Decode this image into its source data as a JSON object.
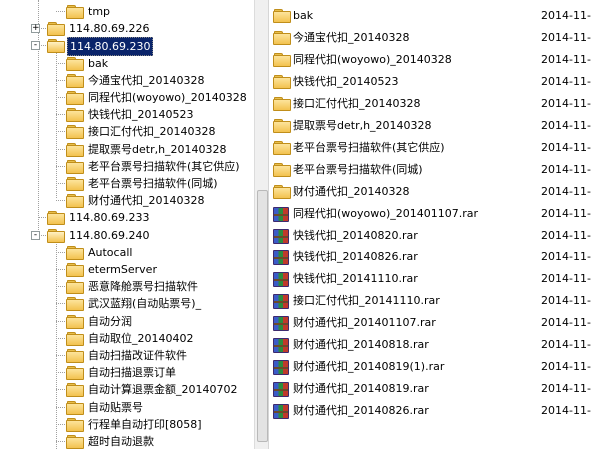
{
  "tree": {
    "items": [
      {
        "label": "tmp",
        "level": 3,
        "expander": ""
      },
      {
        "label": "114.80.69.226",
        "level": 2,
        "expander": "+"
      },
      {
        "label": "114.80.69.230",
        "level": 2,
        "expander": "-",
        "selected": true,
        "open": true
      },
      {
        "label": "bak",
        "level": 3,
        "expander": ""
      },
      {
        "label": "今通宝代扣_20140328",
        "level": 3,
        "expander": ""
      },
      {
        "label": "同程代扣(woyowo)_20140328",
        "level": 3,
        "expander": ""
      },
      {
        "label": "快钱代扣_20140523",
        "level": 3,
        "expander": ""
      },
      {
        "label": "接口汇付代扣_20140328",
        "level": 3,
        "expander": ""
      },
      {
        "label": "提取票号detr,h_20140328",
        "level": 3,
        "expander": ""
      },
      {
        "label": "老平台票号扫描软件(其它供应)",
        "level": 3,
        "expander": ""
      },
      {
        "label": "老平台票号扫描软件(同城)",
        "level": 3,
        "expander": ""
      },
      {
        "label": "财付通代扣_20140328",
        "level": 3,
        "expander": ""
      },
      {
        "label": "114.80.69.233",
        "level": 2,
        "expander": ""
      },
      {
        "label": "114.80.69.240",
        "level": 2,
        "expander": "-",
        "open": true
      },
      {
        "label": "Autocall",
        "level": 3,
        "expander": ""
      },
      {
        "label": "etermServer",
        "level": 3,
        "expander": ""
      },
      {
        "label": "恶意降舱票号扫描软件",
        "level": 3,
        "expander": ""
      },
      {
        "label": "武汉蓝翔(自动贴票号)_",
        "level": 3,
        "expander": ""
      },
      {
        "label": "自动分润",
        "level": 3,
        "expander": ""
      },
      {
        "label": "自动取位_20140402",
        "level": 3,
        "expander": ""
      },
      {
        "label": "自动扫描改证件软件",
        "level": 3,
        "expander": ""
      },
      {
        "label": "自动扫描退票订单",
        "level": 3,
        "expander": ""
      },
      {
        "label": "自动计算退票金额_20140702",
        "level": 3,
        "expander": ""
      },
      {
        "label": "自动贴票号",
        "level": 3,
        "expander": ""
      },
      {
        "label": "行程单自动打印[8058]",
        "level": 3,
        "expander": ""
      },
      {
        "label": "超时自动退款",
        "level": 3,
        "expander": ""
      }
    ]
  },
  "list": {
    "rows": [
      {
        "name": "bak",
        "date": "2014-11-",
        "icon": "folder-icon"
      },
      {
        "name": "今通宝代扣_20140328",
        "date": "2014-11-",
        "icon": "folder-icon"
      },
      {
        "name": "同程代扣(woyowo)_20140328",
        "date": "2014-11-",
        "icon": "folder-icon"
      },
      {
        "name": "快钱代扣_20140523",
        "date": "2014-11-",
        "icon": "folder-icon"
      },
      {
        "name": "接口汇付代扣_20140328",
        "date": "2014-11-",
        "icon": "folder-icon"
      },
      {
        "name": "提取票号detr,h_20140328",
        "date": "2014-11-",
        "icon": "folder-icon"
      },
      {
        "name": "老平台票号扫描软件(其它供应)",
        "date": "2014-11-",
        "icon": "folder-icon"
      },
      {
        "name": "老平台票号扫描软件(同城)",
        "date": "2014-11-",
        "icon": "folder-icon"
      },
      {
        "name": "财付通代扣_20140328",
        "date": "2014-11-",
        "icon": "folder-icon"
      },
      {
        "name": "同程代扣(woyowo)_201401107.rar",
        "date": "2014-11-",
        "icon": "rar-archive-icon"
      },
      {
        "name": "快钱代扣_20140820.rar",
        "date": "2014-11-",
        "icon": "rar-archive-icon"
      },
      {
        "name": "快钱代扣_20140826.rar",
        "date": "2014-11-",
        "icon": "rar-archive-icon"
      },
      {
        "name": "快钱代扣_20141110.rar",
        "date": "2014-11-",
        "icon": "rar-archive-icon"
      },
      {
        "name": "接口汇付代扣_20141110.rar",
        "date": "2014-11-",
        "icon": "rar-archive-icon"
      },
      {
        "name": "财付通代扣_201401107.rar",
        "date": "2014-11-",
        "icon": "rar-archive-icon"
      },
      {
        "name": "财付通代扣_20140818.rar",
        "date": "2014-11-",
        "icon": "rar-archive-icon"
      },
      {
        "name": "财付通代扣_20140819(1).rar",
        "date": "2014-11-",
        "icon": "rar-archive-icon"
      },
      {
        "name": "财付通代扣_20140819.rar",
        "date": "2014-11-",
        "icon": "rar-archive-icon"
      },
      {
        "name": "财付通代扣_20140826.rar",
        "date": "2014-11-",
        "icon": "rar-archive-icon"
      }
    ]
  },
  "colors": {
    "selection": "#0a246a",
    "folder": "#f3c24f"
  }
}
